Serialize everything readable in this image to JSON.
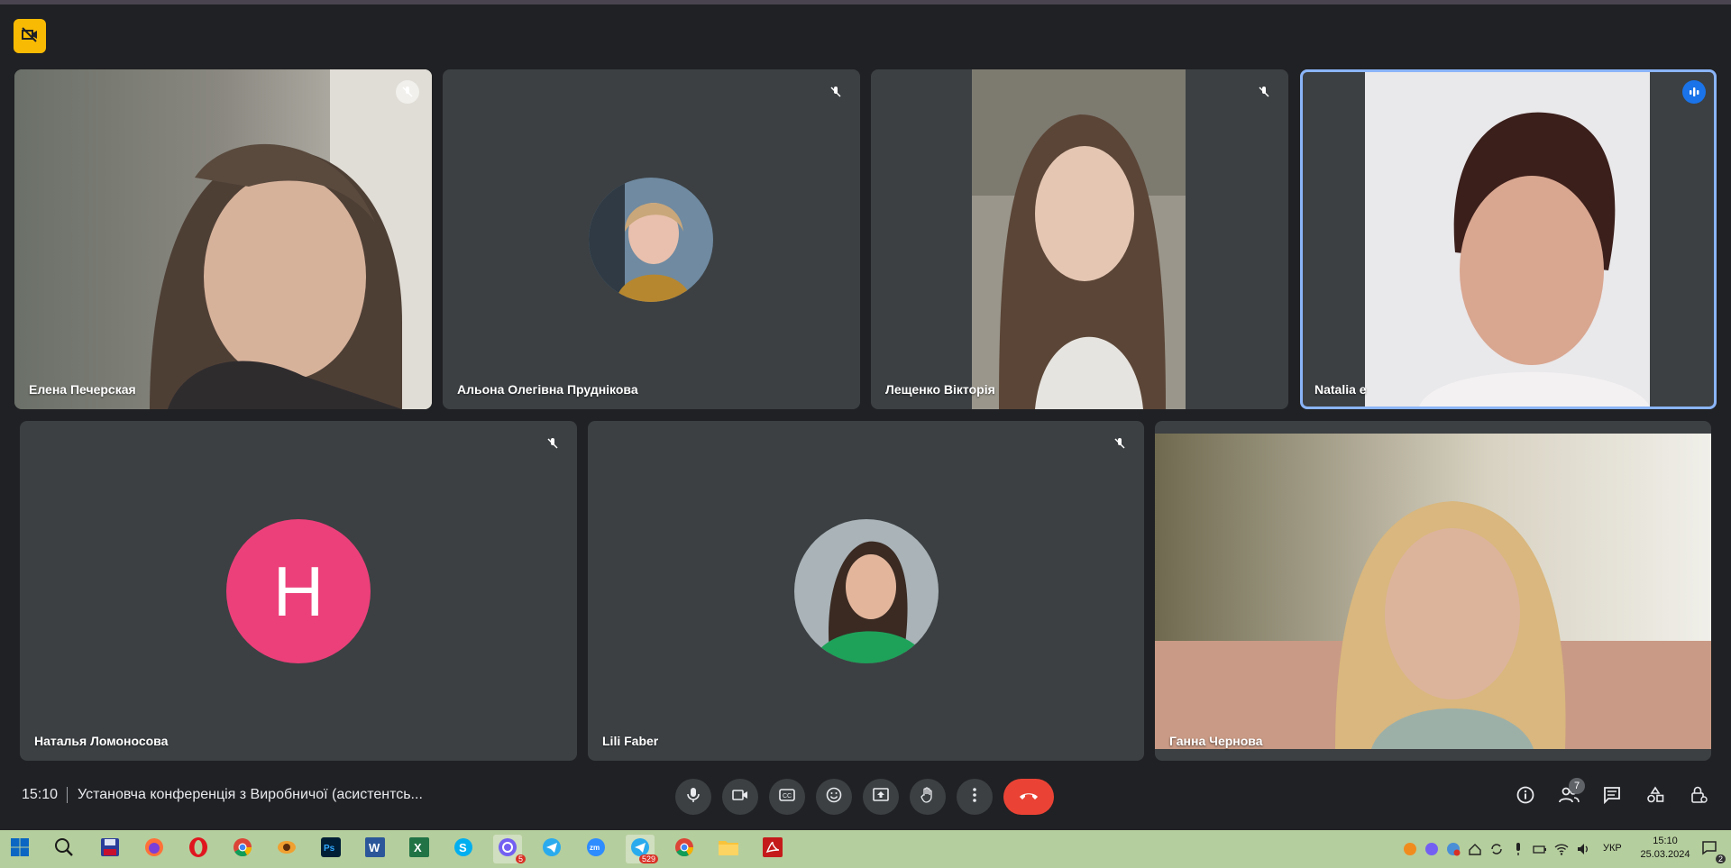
{
  "participants": [
    {
      "name": "Елена Печерская"
    },
    {
      "name": "Альона Олегівна Пруднікова"
    },
    {
      "name": "Лещенко Вікторія"
    },
    {
      "name": "Natalia e"
    },
    {
      "name": "Наталья Ломоносова",
      "initial": "Н"
    },
    {
      "name": "Lili Faber"
    },
    {
      "name": "Ганна Чернова"
    }
  ],
  "toolbar": {
    "time": "15:10",
    "meeting_title": "Установча конференція з Виробничої (асистентсь...",
    "people_count": "7"
  },
  "taskbar": {
    "telegram_badge": "5",
    "telegram2_badge": "529",
    "lang": "УКР",
    "clock_time": "15:10",
    "clock_date": "25.03.2024",
    "notifications": "2"
  },
  "colors": {
    "accent": "#8ab4f8",
    "end_call": "#ea4335",
    "avatar_letter_bg": "#ec407a",
    "taskbar_bg": "#b5ce9d"
  }
}
